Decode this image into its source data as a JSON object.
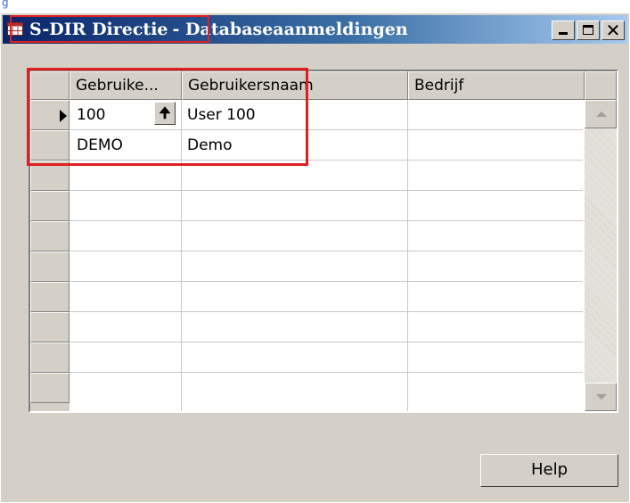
{
  "top_strip": {
    "text": "g"
  },
  "window": {
    "title_part1": "S-DIR Directie",
    "title_part2": "- Databaseaanmeldingen",
    "close_glyph": "✕",
    "title_gradient_start": "#0a246a",
    "title_gradient_end": "#a6caf0"
  },
  "grid": {
    "columns": [
      "Gebruike...",
      "Gebruikersnaam",
      "Bedrijf"
    ],
    "rows": [
      {
        "user_id": "100",
        "user_name": "User 100",
        "company": "",
        "current": true
      },
      {
        "user_id": "DEMO",
        "user_name": "Demo",
        "company": "",
        "current": false
      }
    ],
    "lookup_icon": "up-arrow-icon",
    "lookup_glyph": "🠉",
    "empty_row_count": 8
  },
  "buttons": {
    "help_label": "Help"
  },
  "colors": {
    "highlight": "#e02020",
    "window_face": "#d4d0c8"
  }
}
